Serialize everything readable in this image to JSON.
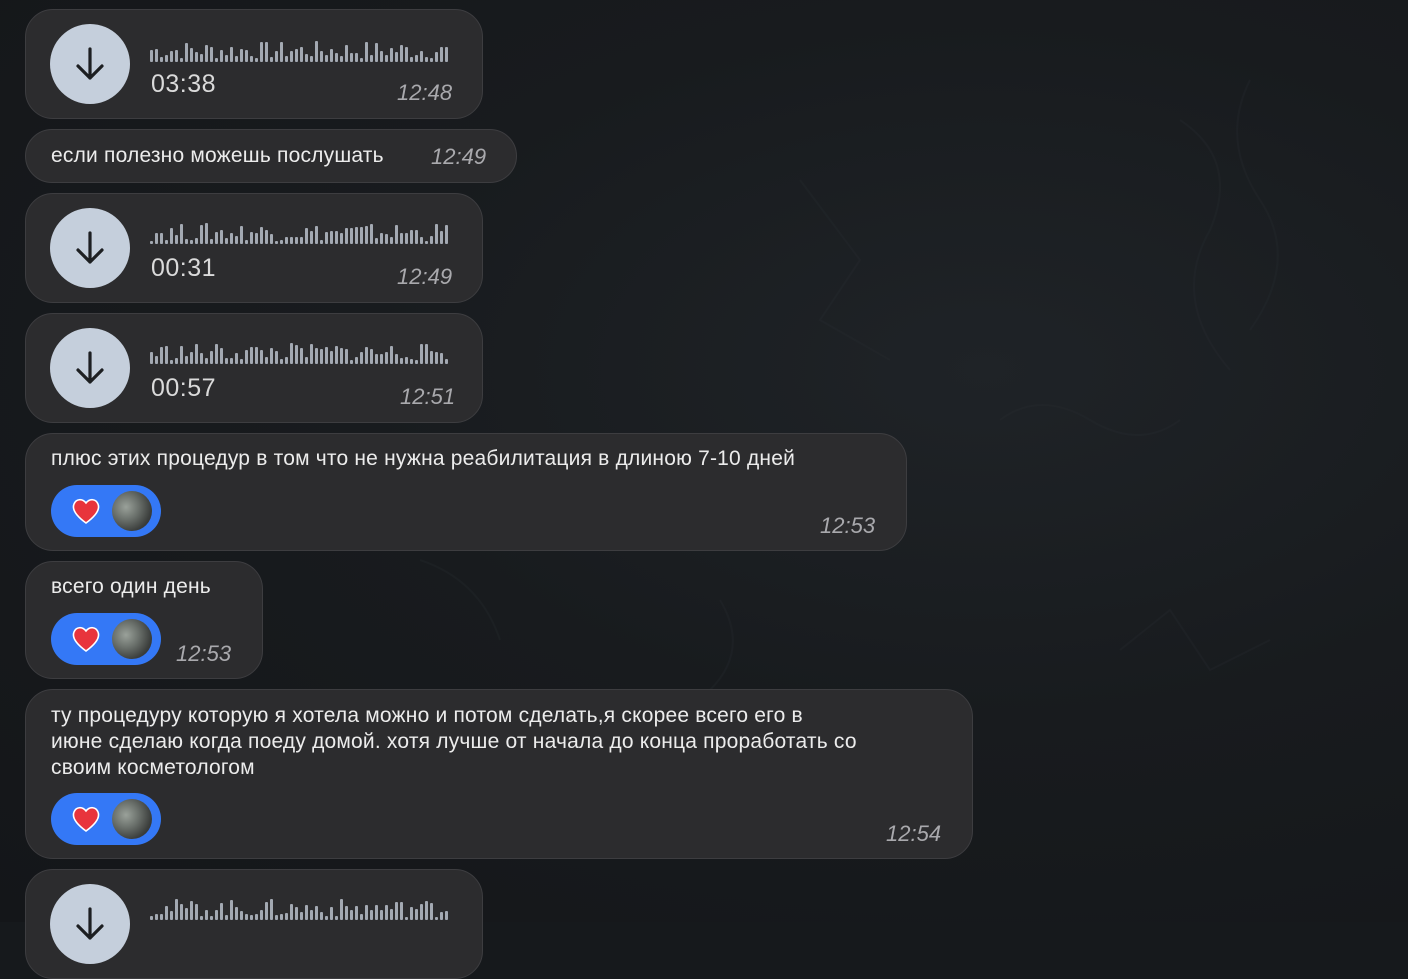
{
  "messages": [
    {
      "kind": "voice",
      "duration": "03:38",
      "time": "12:48"
    },
    {
      "kind": "text",
      "text": "если полезно можешь послушать",
      "time": "12:49"
    },
    {
      "kind": "voice",
      "duration": "00:31",
      "time": "12:49"
    },
    {
      "kind": "voice",
      "duration": "00:57",
      "time": "12:51"
    },
    {
      "kind": "text",
      "text": "плюс этих процедур в том что не нужна реабилитация в длиною 7-10 дней",
      "time": "12:53",
      "reaction": "heart"
    },
    {
      "kind": "text",
      "text": "всего один день",
      "time": "12:53",
      "reaction": "heart"
    },
    {
      "kind": "text",
      "lines": [
        "ту процедуру которую я хотела можно и потом сделать,я скорее всего его в",
        "июне сделаю когда поеду домой. хотя лучше от начала до конца проработать со",
        "своим косметологом"
      ],
      "time": "12:54",
      "reaction": "heart"
    },
    {
      "kind": "voice"
    }
  ],
  "colors": {
    "bubble": "#2c2c2e",
    "reaction": "#3478f6",
    "download_button": "#c5cfdc",
    "heart": "#e8343c"
  },
  "icons": {
    "download": "arrow-down-icon",
    "reaction": "heart-icon"
  }
}
